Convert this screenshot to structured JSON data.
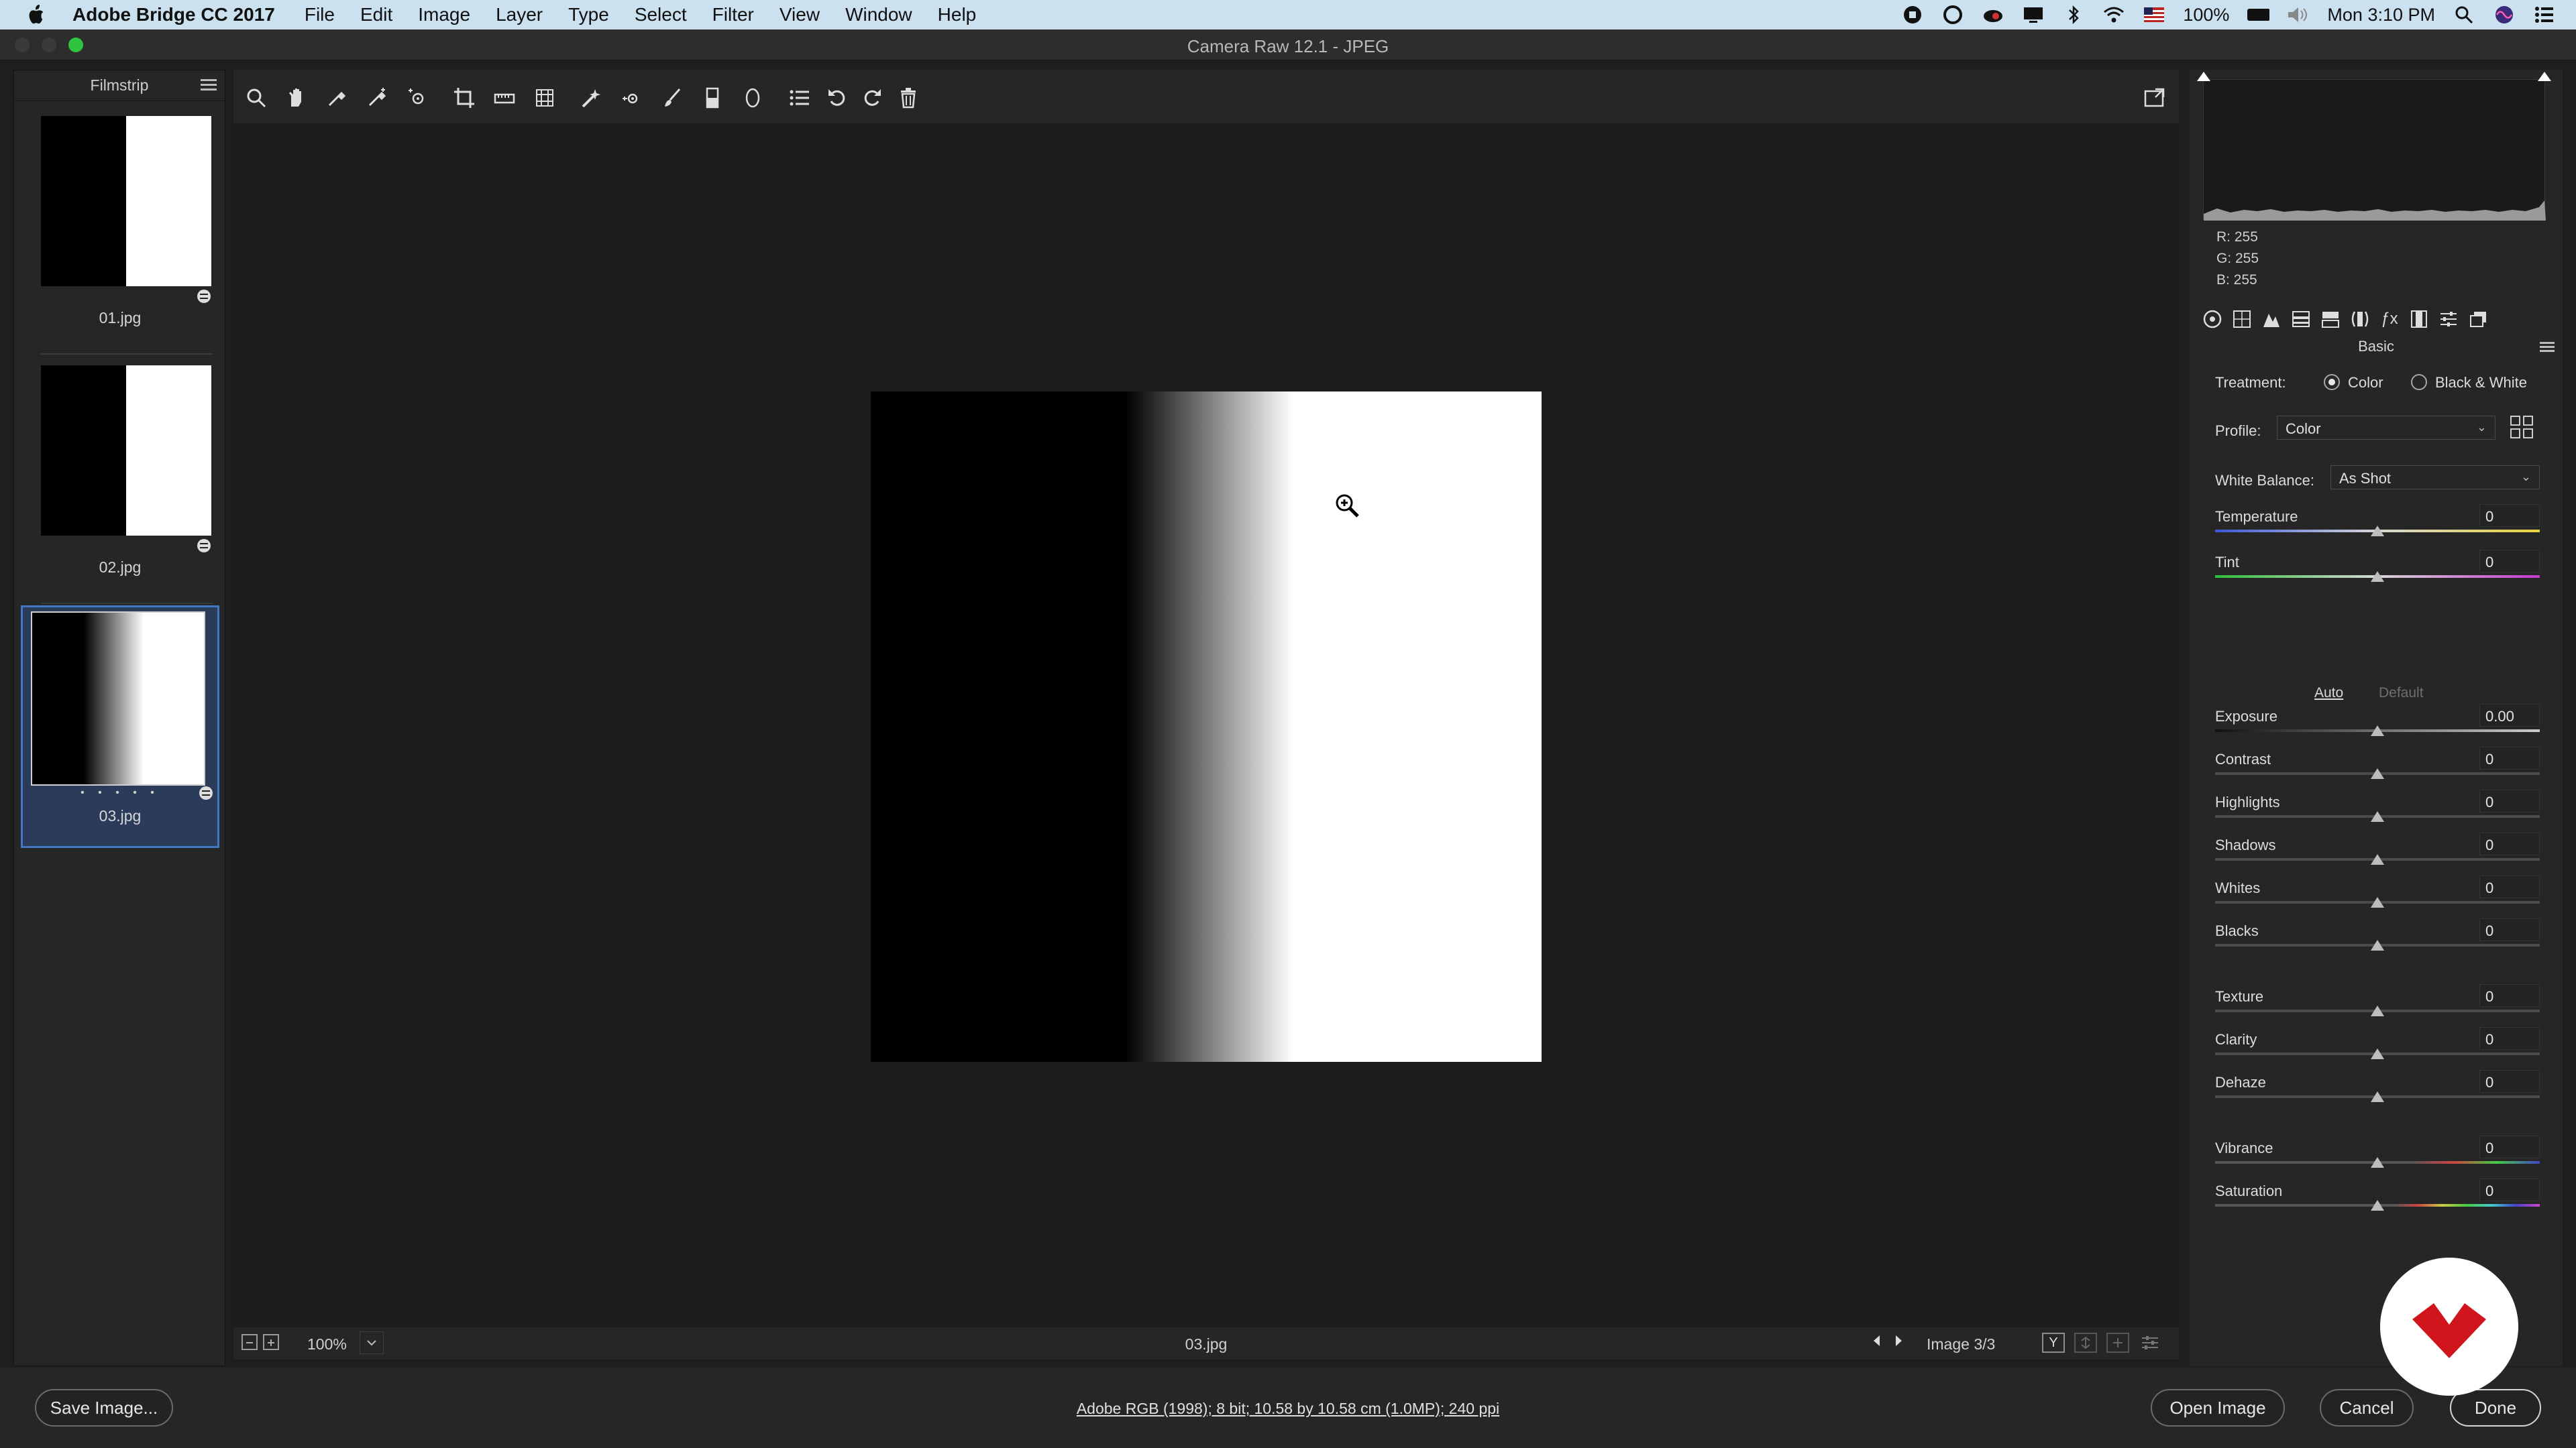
{
  "menubar": {
    "app_name": "Adobe Bridge CC 2017",
    "menus": [
      "File",
      "Edit",
      "Image",
      "Layer",
      "Type",
      "Select",
      "Filter",
      "View",
      "Window",
      "Help"
    ],
    "battery": "100%",
    "clock": "Mon 3:10 PM"
  },
  "window": {
    "title": "Camera Raw 12.1  -  JPEG"
  },
  "filmstrip": {
    "title": "Filmstrip",
    "items": [
      {
        "name": "01.jpg",
        "rating_dots": ""
      },
      {
        "name": "02.jpg",
        "rating_dots": ""
      },
      {
        "name": "03.jpg",
        "rating_dots": "• • • • •"
      }
    ],
    "selected_index": 2
  },
  "toolbar": {
    "tools": [
      "zoom-tool-icon",
      "hand-tool-icon",
      "white-balance-tool-icon",
      "color-sampler-tool-icon",
      "targeted-adjustment-tool-icon",
      "crop-tool-icon",
      "straighten-tool-icon",
      "transform-tool-icon",
      "spot-removal-tool-icon",
      "red-eye-tool-icon",
      "adjustment-brush-icon",
      "graduated-filter-icon",
      "radial-filter-icon",
      "preferences-list-icon",
      "rotate-left-icon",
      "rotate-right-icon",
      "trash-icon"
    ]
  },
  "status": {
    "zoom": "100%",
    "filename": "03.jpg",
    "image_counter": "Image 3/3",
    "view_mode_label": "Y"
  },
  "histogram": {
    "r": "R:  255",
    "g": "G:  255",
    "b": "B:  255"
  },
  "panel": {
    "title": "Basic",
    "treatment_label": "Treatment:",
    "treatment_options": [
      "Color",
      "Black & White"
    ],
    "treatment_selected": "Color",
    "profile_label": "Profile:",
    "profile_value": "Color",
    "wb_label": "White Balance:",
    "wb_value": "As Shot",
    "auto_label": "Auto",
    "default_label": "Default",
    "sliders": [
      {
        "label": "Temperature",
        "value": "0",
        "position": 0.5
      },
      {
        "label": "Tint",
        "value": "0",
        "position": 0.5
      },
      {
        "label": "Exposure",
        "value": "0.00",
        "position": 0.5
      },
      {
        "label": "Contrast",
        "value": "0",
        "position": 0.5
      },
      {
        "label": "Highlights",
        "value": "0",
        "position": 0.5
      },
      {
        "label": "Shadows",
        "value": "0",
        "position": 0.5
      },
      {
        "label": "Whites",
        "value": "0",
        "position": 0.5
      },
      {
        "label": "Blacks",
        "value": "0",
        "position": 0.5
      },
      {
        "label": "Texture",
        "value": "0",
        "position": 0.5
      },
      {
        "label": "Clarity",
        "value": "0",
        "position": 0.5
      },
      {
        "label": "Dehaze",
        "value": "0",
        "position": 0.5
      },
      {
        "label": "Vibrance",
        "value": "0",
        "position": 0.5
      },
      {
        "label": "Saturation",
        "value": "0",
        "position": 0.5
      }
    ]
  },
  "bottom": {
    "save_label": "Save Image...",
    "workflow_text": "Adobe RGB (1998); 8 bit; 10.58 by 10.58 cm (1.0MP); 240 ppi",
    "open_label": "Open Image",
    "cancel_label": "Cancel",
    "done_label": "Done"
  },
  "colors": {
    "menubar_bg": "#cbe1f0",
    "panel_bg": "#262626",
    "canvas_bg": "#1d1d1d",
    "selection": "#4476c7",
    "logo_red": "#d0161c"
  }
}
